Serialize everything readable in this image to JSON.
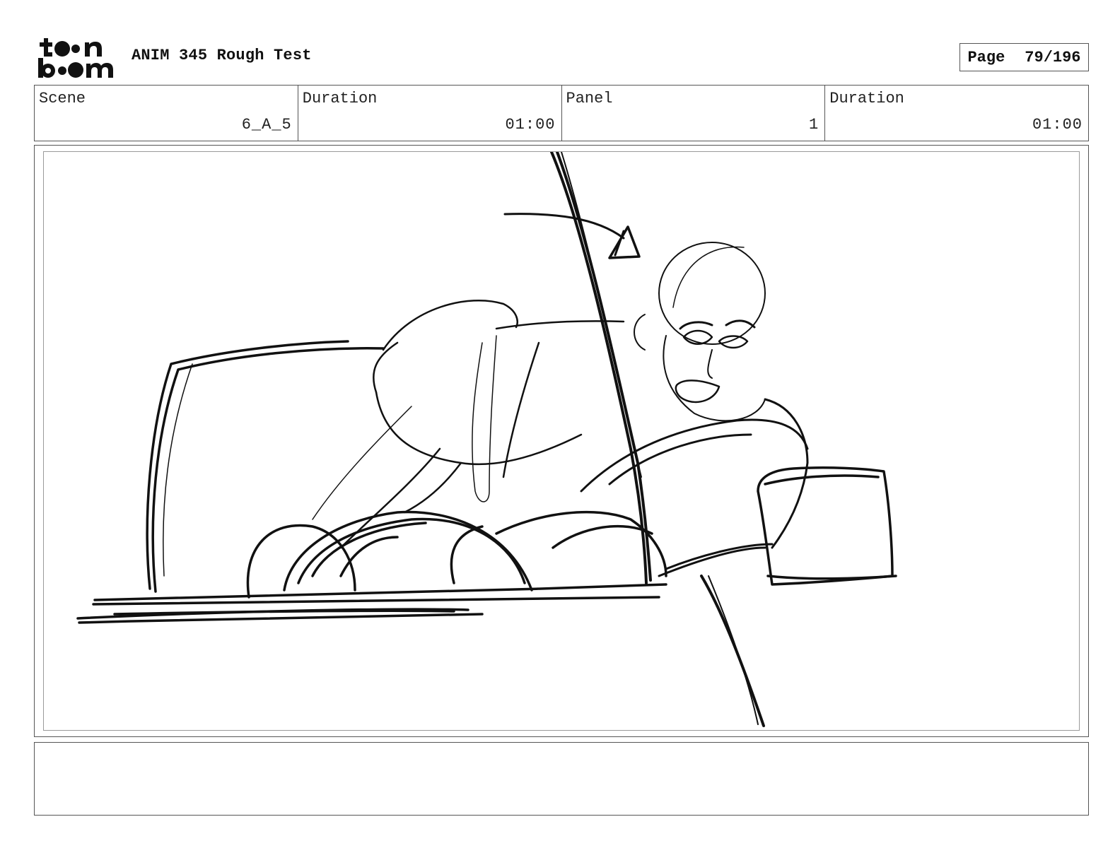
{
  "header": {
    "logo_line1": "toon",
    "logo_line2": "boom",
    "project_title": "ANIM 345 Rough Test",
    "page_label": "Page",
    "page_number": "79/196"
  },
  "info": {
    "scene_label": "Scene",
    "scene_value": "6_A_5",
    "scene_duration_label": "Duration",
    "scene_duration_value": "01:00",
    "panel_label": "Panel",
    "panel_value": "1",
    "panel_duration_label": "Duration",
    "panel_duration_value": "01:00"
  },
  "panel": {
    "content": "rough-sketch-drawing"
  },
  "notes": {
    "text": ""
  },
  "colors": {
    "ink": "#111111",
    "border": "#555555",
    "inner_border": "#9a9a9a",
    "background": "#ffffff"
  }
}
